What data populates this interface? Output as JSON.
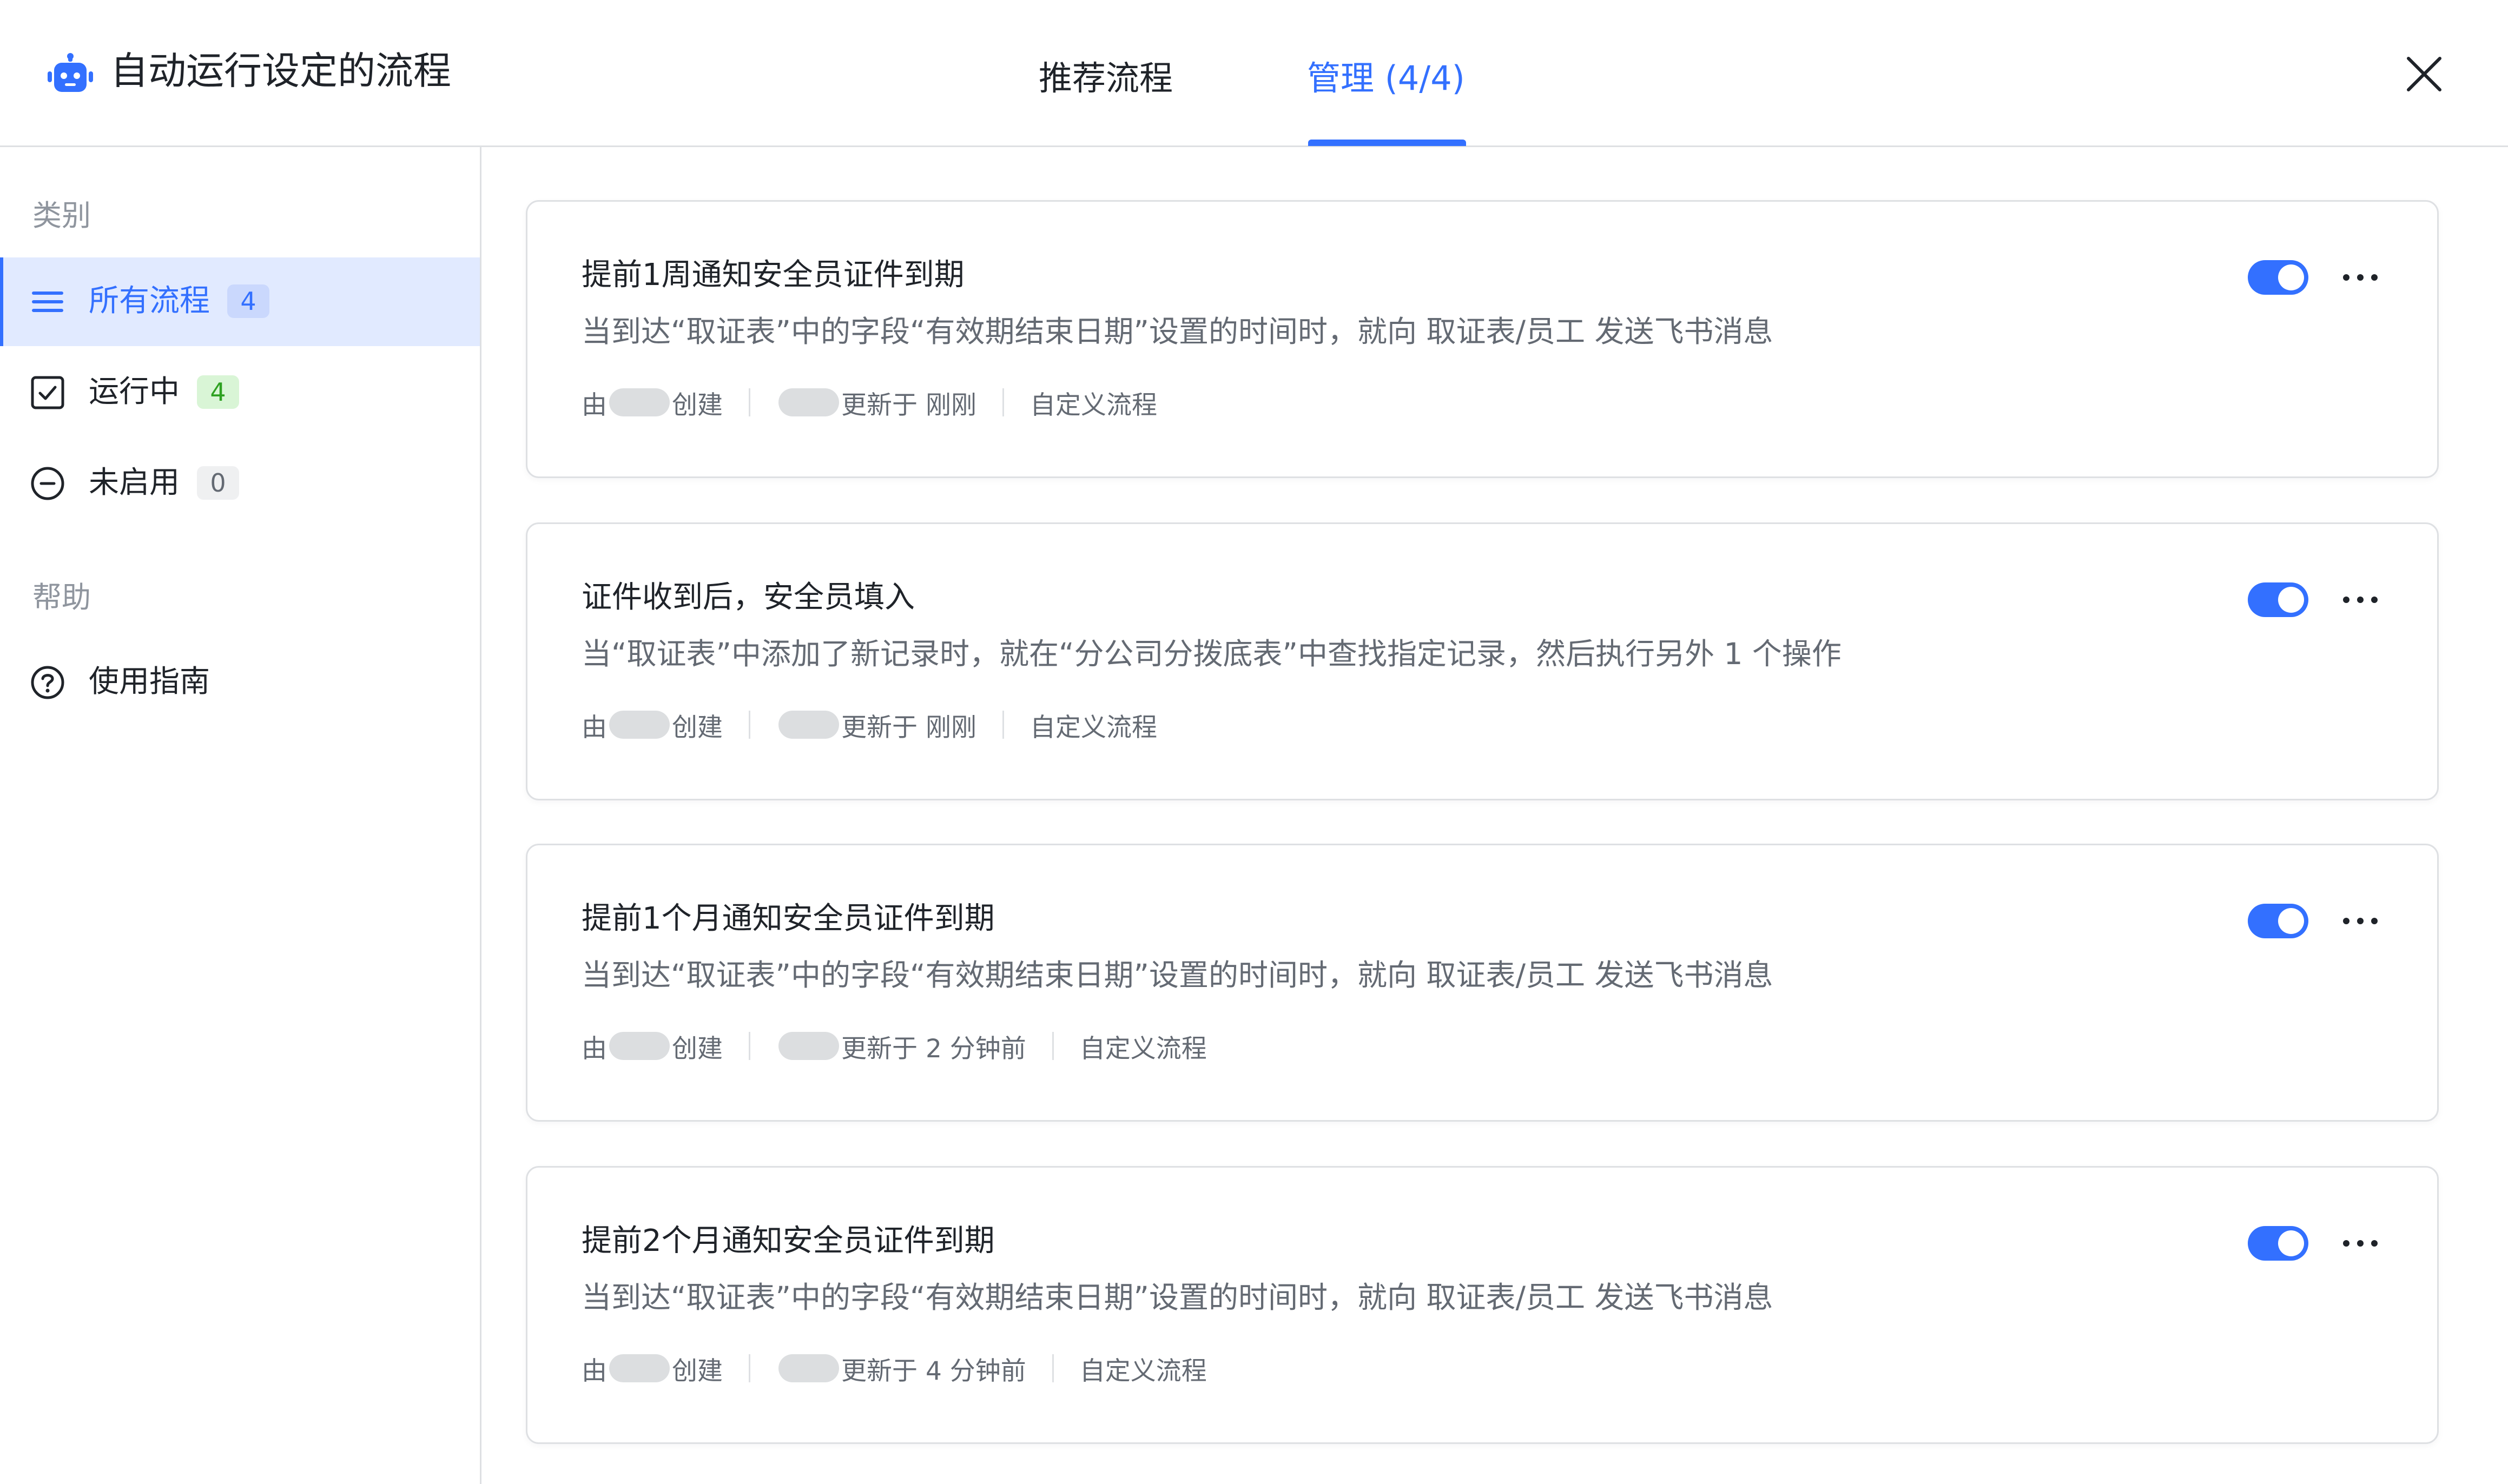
{
  "app": {
    "title": "自动运行设定的流程",
    "logo_icon": "robot-icon",
    "accent_color": "#3370ff"
  },
  "tabs": [
    {
      "label": "推荐流程",
      "active": false
    },
    {
      "label": "管理 (4/4)",
      "active": true
    }
  ],
  "sidebar": {
    "category_title": "类别",
    "items": [
      {
        "label": "所有流程",
        "count": "4",
        "icon": "list-icon",
        "active": true
      },
      {
        "label": "运行中",
        "count": "4",
        "icon": "checkbox-icon",
        "active": false
      },
      {
        "label": "未启用",
        "count": "0",
        "icon": "minus-circle-icon",
        "active": false
      }
    ],
    "help_title": "帮助",
    "help_items": [
      {
        "label": "使用指南",
        "icon": "question-circle-icon"
      }
    ]
  },
  "flows": [
    {
      "title": "提前1周通知安全员证件到期",
      "description": "当到达“取证表”中的字段“有效期结束日期”设置的时间时，就向 取证表/员工 发送飞书消息",
      "meta": {
        "created_prefix": "由",
        "created_suffix": "创建",
        "updated": "更新于 刚刚",
        "type": "自定义流程"
      },
      "enabled": true
    },
    {
      "title": "证件收到后，安全员填入",
      "description": "当“取证表”中添加了新记录时，就在“分公司分拨底表”中查找指定记录，然后执行另外 1 个操作",
      "meta": {
        "created_prefix": "由",
        "created_suffix": "创建",
        "updated": "更新于 刚刚",
        "type": "自定义流程"
      },
      "enabled": true
    },
    {
      "title": "提前1个月通知安全员证件到期",
      "description": "当到达“取证表”中的字段“有效期结束日期”设置的时间时，就向 取证表/员工 发送飞书消息",
      "meta": {
        "created_prefix": "由",
        "created_suffix": "创建",
        "updated": "更新于 2 分钟前",
        "type": "自定义流程"
      },
      "enabled": true
    },
    {
      "title": "提前2个月通知安全员证件到期",
      "description": "当到达“取证表”中的字段“有效期结束日期”设置的时间时，就向 取证表/员工 发送飞书消息",
      "meta": {
        "created_prefix": "由",
        "created_suffix": "创建",
        "updated": "更新于 4 分钟前",
        "type": "自定义流程"
      },
      "enabled": true
    }
  ]
}
